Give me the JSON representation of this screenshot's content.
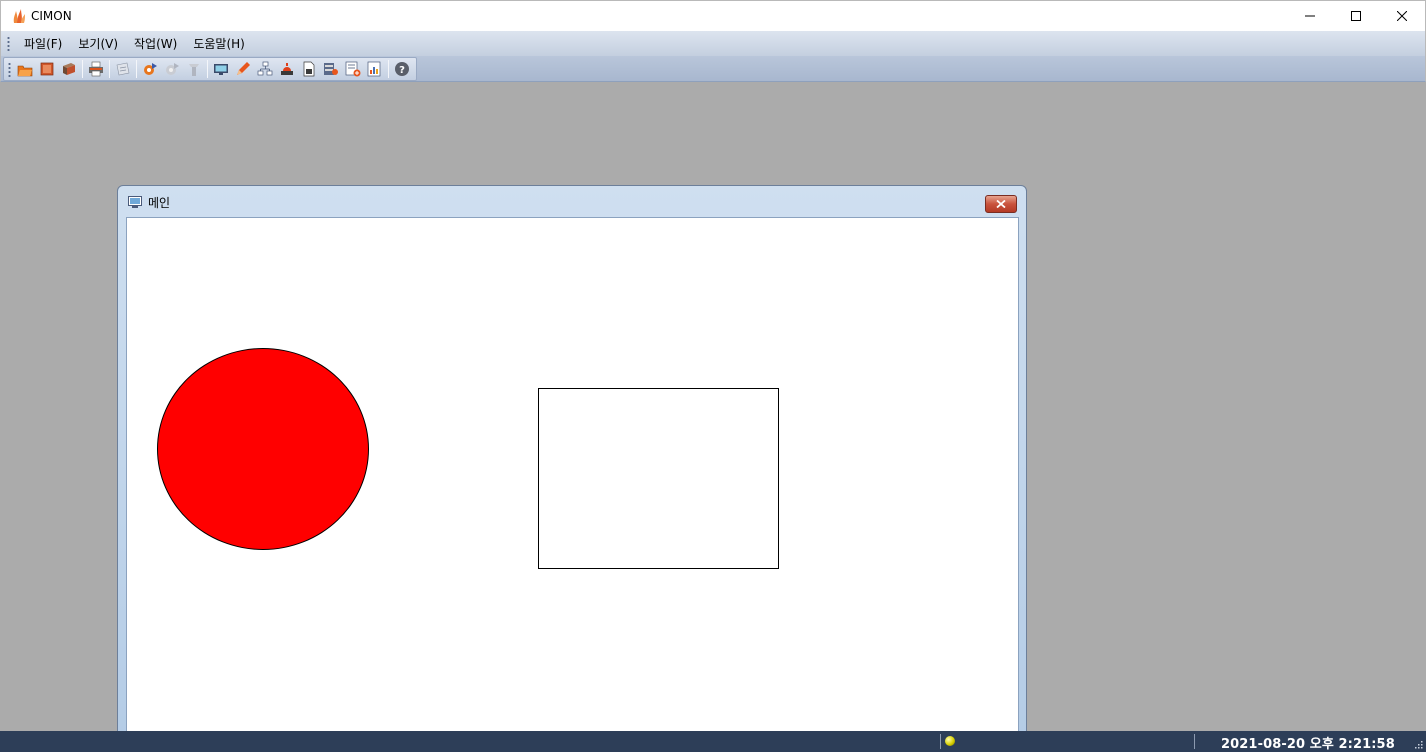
{
  "window": {
    "title": "CIMON",
    "minimize_icon": "minimize-icon",
    "maximize_icon": "maximize-icon",
    "close_icon": "close-icon"
  },
  "menu": {
    "items": [
      {
        "label": "파일(F)"
      },
      {
        "label": "보기(V)"
      },
      {
        "label": "작업(W)"
      },
      {
        "label": "도움말(H)"
      }
    ]
  },
  "toolbar": {
    "buttons": [
      {
        "icon": "open-project-icon"
      },
      {
        "icon": "stop-icon"
      },
      {
        "icon": "save-icon"
      },
      {
        "icon": "print-icon"
      },
      {
        "icon": "print-preview-icon"
      },
      {
        "icon": "run-icon"
      },
      {
        "icon": "tag-icon"
      },
      {
        "icon": "trend-icon"
      },
      {
        "icon": "monitor-icon"
      },
      {
        "icon": "edit-pencil-icon"
      },
      {
        "icon": "network-icon"
      },
      {
        "icon": "alarm-icon"
      },
      {
        "icon": "document-icon"
      },
      {
        "icon": "database-icon"
      },
      {
        "icon": "add-report-icon"
      },
      {
        "icon": "chart-report-icon"
      },
      {
        "icon": "help-icon"
      }
    ]
  },
  "child_window": {
    "title": "메인",
    "close_icon": "close-icon"
  },
  "canvas": {
    "shapes": [
      {
        "type": "circle",
        "fill": "#ff0000",
        "stroke": "#000000"
      },
      {
        "type": "rectangle",
        "fill": "#ffffff",
        "stroke": "#000000"
      }
    ]
  },
  "statusbar": {
    "indicator_color": "#e0d800",
    "datetime": "2021-08-20 오후 2:21:58"
  }
}
